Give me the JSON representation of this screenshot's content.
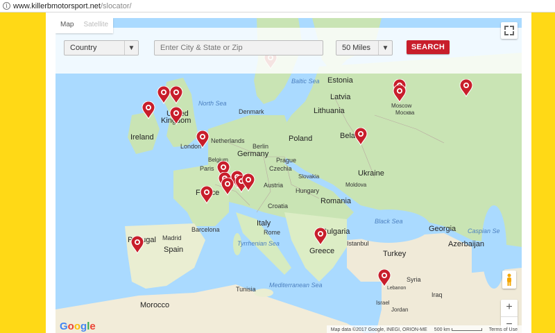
{
  "browser": {
    "url_host": "www.killerbmotorsport.net",
    "url_path": "/slocator/",
    "info_icon": "info-icon"
  },
  "search": {
    "country_value": "Country",
    "city_placeholder": "Enter City & State or Zip",
    "radius_value": "50 Miles",
    "search_label": "SEARCH"
  },
  "map_controls": {
    "map_label": "Map",
    "satellite_label": "Satellite",
    "zoom_in": "+",
    "zoom_out": "−",
    "google_logo": "Google",
    "map_data": "Map data ©2017 Google, INEGI, ORION-ME",
    "scale": "500 km",
    "terms": "Terms of Use"
  },
  "labels": {
    "estonia": "Estonia",
    "latvia": "Latvia",
    "lithuania": "Lithuania",
    "belarus": "Belarus",
    "moscow": "Moscow",
    "moscow_ru": "Москва",
    "uk": "United",
    "kingdom": "Kingdom",
    "ireland": "Ireland",
    "london": "London",
    "north_sea": "North Sea",
    "baltic_sea": "Baltic Sea",
    "denmark": "Denmark",
    "netherlands": "Netherlands",
    "berlin": "Berlin",
    "germany": "Germany",
    "poland": "Poland",
    "paris": "Paris",
    "prague": "Prague",
    "czechia": "Czechia",
    "slovakia": "Slovakia",
    "austria": "Austria",
    "hungary": "Hungary",
    "ukraine": "Ukraine",
    "moldova": "Moldova",
    "france": "France",
    "romania": "Romania",
    "croatia": "Croatia",
    "black_sea": "Black Sea",
    "georgia": "Georgia",
    "caspian": "Caspian Se",
    "portugal": "Portugal",
    "madrid": "Madrid",
    "barcelona": "Barcelona",
    "spain": "Spain",
    "italy": "Italy",
    "rome": "Rome",
    "bulgaria": "Bulgaria",
    "istanbul": "Istanbul",
    "greece": "Greece",
    "turkey": "Turkey",
    "azerbaijan": "Azerbaijan",
    "tyrrhenian": "Tyrrhenian Sea",
    "mediterranean": "Mediterranean Sea",
    "tunisia": "Tunisia",
    "syria": "Syria",
    "iraq": "Iraq",
    "morocco": "Morocco",
    "israel": "Israel",
    "jordan": "Jordan",
    "lebanon": "Lebanon",
    "belgium": "Belgium"
  },
  "colors": {
    "page_bg": "#ffd916",
    "water": "#aadaff",
    "land": "#c9e4b4",
    "land_south": "#f0ead8",
    "marker": "#c81e2b",
    "search_button": "#c81e2b"
  }
}
